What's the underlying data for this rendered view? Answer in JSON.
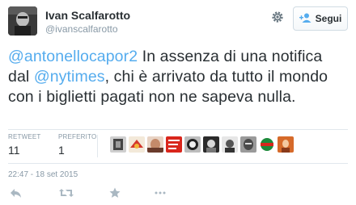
{
  "user": {
    "full_name": "Ivan Scalfarotto",
    "screen_name": "@ivanscalfarotto"
  },
  "header": {
    "follow_label": "Segui",
    "follow_icon": "add-user-icon",
    "settings_icon": "gear-icon"
  },
  "tweet": {
    "mention1": "@antonellocapor2",
    "text1": " In assenza di una notifica dal ",
    "mention2": "@nytimes",
    "text2": ", chi è arrivato da tutto il mondo con i biglietti pagati non ne sapeva nulla."
  },
  "stats": {
    "retweet_label": "RETWEET",
    "retweet_count": "11",
    "favorite_label": "PREFERITO",
    "favorite_count": "1"
  },
  "timestamp": "22:47 - 18 set 2015",
  "actions": [
    "reply-icon",
    "retweet-icon",
    "favorite-icon",
    "more-icon"
  ],
  "colors": {
    "accent": "#55acee",
    "text": "#292f33",
    "muted": "#8899a6",
    "divider": "#e1e8ed"
  }
}
